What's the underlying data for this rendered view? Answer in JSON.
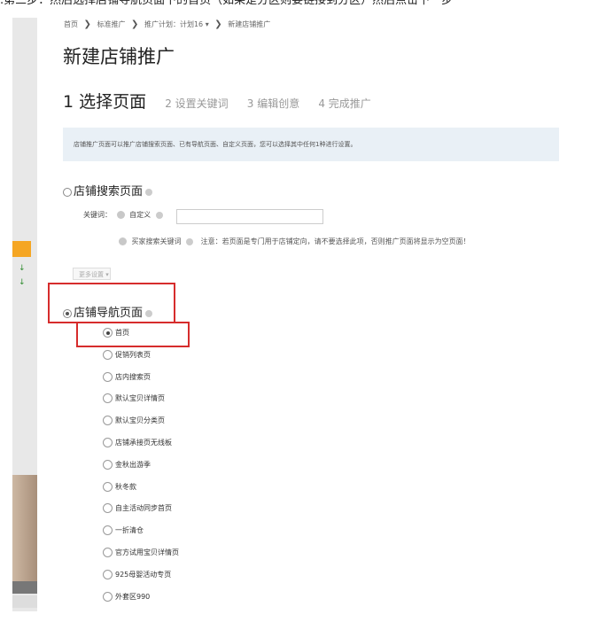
{
  "caption": ".第三步：然后选择店铺导航页面下的首页（如果是分区则要链接到分区）然后点击下一步",
  "breadcrumb": {
    "items": [
      "首页",
      "标准推广",
      "推广计划：计划16 ▾",
      "新建店铺推广"
    ],
    "separator": "❯"
  },
  "page_title": "新建店铺推广",
  "steps": {
    "active": "1 选择页面",
    "others": [
      "2 设置关键词",
      "3 编辑创意",
      "4 完成推广"
    ]
  },
  "notice": "店铺推广页面可以推广店铺搜索页面、已有导航页面、自定义页面，您可以选择其中任何1种进行设置。",
  "search_section": {
    "label": "店铺搜索页面",
    "keyword_label": "关键词：",
    "custom_label": "自定义",
    "keyword_value": "",
    "buyer_label": "买家搜索关键词",
    "buyer_note": "注意：若页面是专门用于店铺定向，请不要选择此项，否则推广页面将显示为空页面！",
    "more_settings": "更多设置 ▾"
  },
  "nav_section": {
    "label": "店铺导航页面",
    "selected_index": 0,
    "items": [
      "首页",
      "促销列表页",
      "店内搜索页",
      "默认宝贝详情页",
      "默认宝贝分类页",
      "店铺承接页无线板",
      "金秋出游季",
      "秋冬款",
      "自主活动同步首页",
      "一折清仓",
      "官方试用宝贝详情页",
      "925母婴活动专页",
      "外套区990"
    ]
  },
  "left_strip": {
    "arrow": "↓"
  },
  "colors": {
    "highlight_red": "#d62c2c",
    "notice_bg": "#e9f0f6",
    "accent_orange": "#f5a623"
  }
}
